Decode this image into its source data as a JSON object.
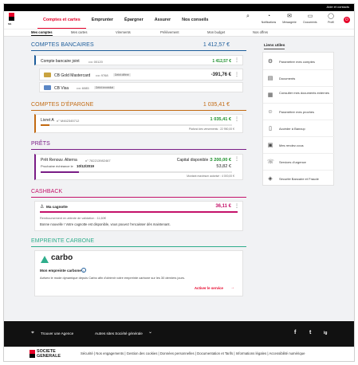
{
  "top_strip": {
    "hint": "Aide et contacts"
  },
  "header": {
    "logo_text": "SG",
    "nav": [
      "Comptes et cartes",
      "Emprunter",
      "Épargner",
      "Assurer",
      "Nos conseils"
    ],
    "icons": [
      {
        "name": "search-icon",
        "glyph": "⌕",
        "label": ""
      },
      {
        "name": "bell-icon",
        "glyph": "🔔",
        "label": "Notifications"
      },
      {
        "name": "mail-icon",
        "glyph": "✉",
        "label": "Messagerie"
      },
      {
        "name": "folder-icon",
        "glyph": "▭",
        "label": "Documents"
      },
      {
        "name": "user-icon",
        "glyph": "◯",
        "label": "Profil"
      }
    ],
    "power_glyph": "⏻"
  },
  "subnav": [
    "Mes comptes",
    "Mes cartes",
    "Virements",
    "Prélèvement",
    "Mon budget",
    "Nos offres"
  ],
  "sections": {
    "bancaires": {
      "title": "COMPTES BANCAIRES",
      "total": "1 412,57 €",
      "account": {
        "name": "Compte bancaire joint",
        "number": "•••• 00120",
        "amount": "1 412,57 €"
      },
      "cards": [
        {
          "name": "CB Gold Mastercard",
          "number": "•••• 9768",
          "badge": "Débit différé",
          "amount": "-391,76 €"
        },
        {
          "name": "CB Visa",
          "number": "•••• 6085",
          "badge": "Débit immédiat",
          "amount": ""
        }
      ]
    },
    "epargne": {
      "title": "COMPTES D'ÉPARGNE",
      "total": "1 035,41 €",
      "account": {
        "name": "Livret A",
        "number": "n° M462345712",
        "amount": "1 035,41 €",
        "note": "Plafond des versements : 22 950,00 €"
      }
    },
    "prets": {
      "title": "PRÊTS",
      "loan": {
        "name": "Prêt Renouv. Alterna",
        "number": "n° 782213982467",
        "capital_label": "Capital disponible :",
        "capital": "3 200,00 €",
        "next_label": "Prochaine échéance le",
        "next_date": "10/12/2019",
        "next_amount": "53,82 €",
        "note": "Montant maximum autorisé : 4 000,00 €"
      }
    },
    "cashback": {
      "title": "CASHBACK",
      "cagnotte": {
        "name": "Ma cagnotte",
        "amount": "36,11 €",
        "pending": "Remboursement en attente de validation : 11,60€",
        "message": "Bonne nouvelle ! Votre cagnotte est disponible, vous pouvez l'encaisser dès maintenant."
      }
    },
    "carbone": {
      "title": "EMPREINTE CARBONE",
      "brand": "carbo",
      "heading": "Mon empreinte carbone",
      "info_glyph": "i",
      "text": "Activez le mode dynamique depuis Carbo afin d'obtenir votre empreinte carbone sur les 30 derniers jours.",
      "cta": "Activer le service",
      "cta_arrow": "→"
    }
  },
  "sidebar": {
    "title": "Liens utiles",
    "items": [
      {
        "name": "sliders-icon",
        "glyph": "⚙",
        "label": "Paramétrer mes comptes"
      },
      {
        "name": "document-icon",
        "glyph": "▤",
        "label": "Documents"
      },
      {
        "name": "external-accounts-icon",
        "glyph": "▦",
        "label": "Consulter mes documents externes"
      },
      {
        "name": "people-icon",
        "glyph": "☺",
        "label": "Paramétrer mes proches"
      },
      {
        "name": "phone-icon",
        "glyph": "▯",
        "label": "Accéder à Banxup"
      },
      {
        "name": "calendar-icon",
        "glyph": "▣",
        "label": "Mes rendez-vous"
      },
      {
        "name": "emergency-icon",
        "glyph": "☏",
        "label": "Services d'urgence"
      },
      {
        "name": "shield-icon",
        "glyph": "◈",
        "label": "Sécurité Bancaire et Fraude"
      }
    ]
  },
  "footer": {
    "agency": "Trouver une Agence",
    "sites": "Autres sites Société générale",
    "chevron": "⌄",
    "social": [
      "f",
      "t",
      "ig"
    ]
  },
  "legal": {
    "brand_line1": "SOCIETE",
    "brand_line2": "GENERALE",
    "links": "Sécurité | Nos engagements | Gestion des cookies | Données personnelles | Documentation et Tarifs | Informations légales | Accessibilité numérique"
  },
  "colors": {
    "brand_red": "#e60028",
    "bancaires": "#1d5d9b",
    "epargne": "#c26a12",
    "prets": "#7a1d86",
    "cashback": "#c4126a",
    "carbone": "#2fae8c",
    "positive": "#1b8f2a"
  }
}
